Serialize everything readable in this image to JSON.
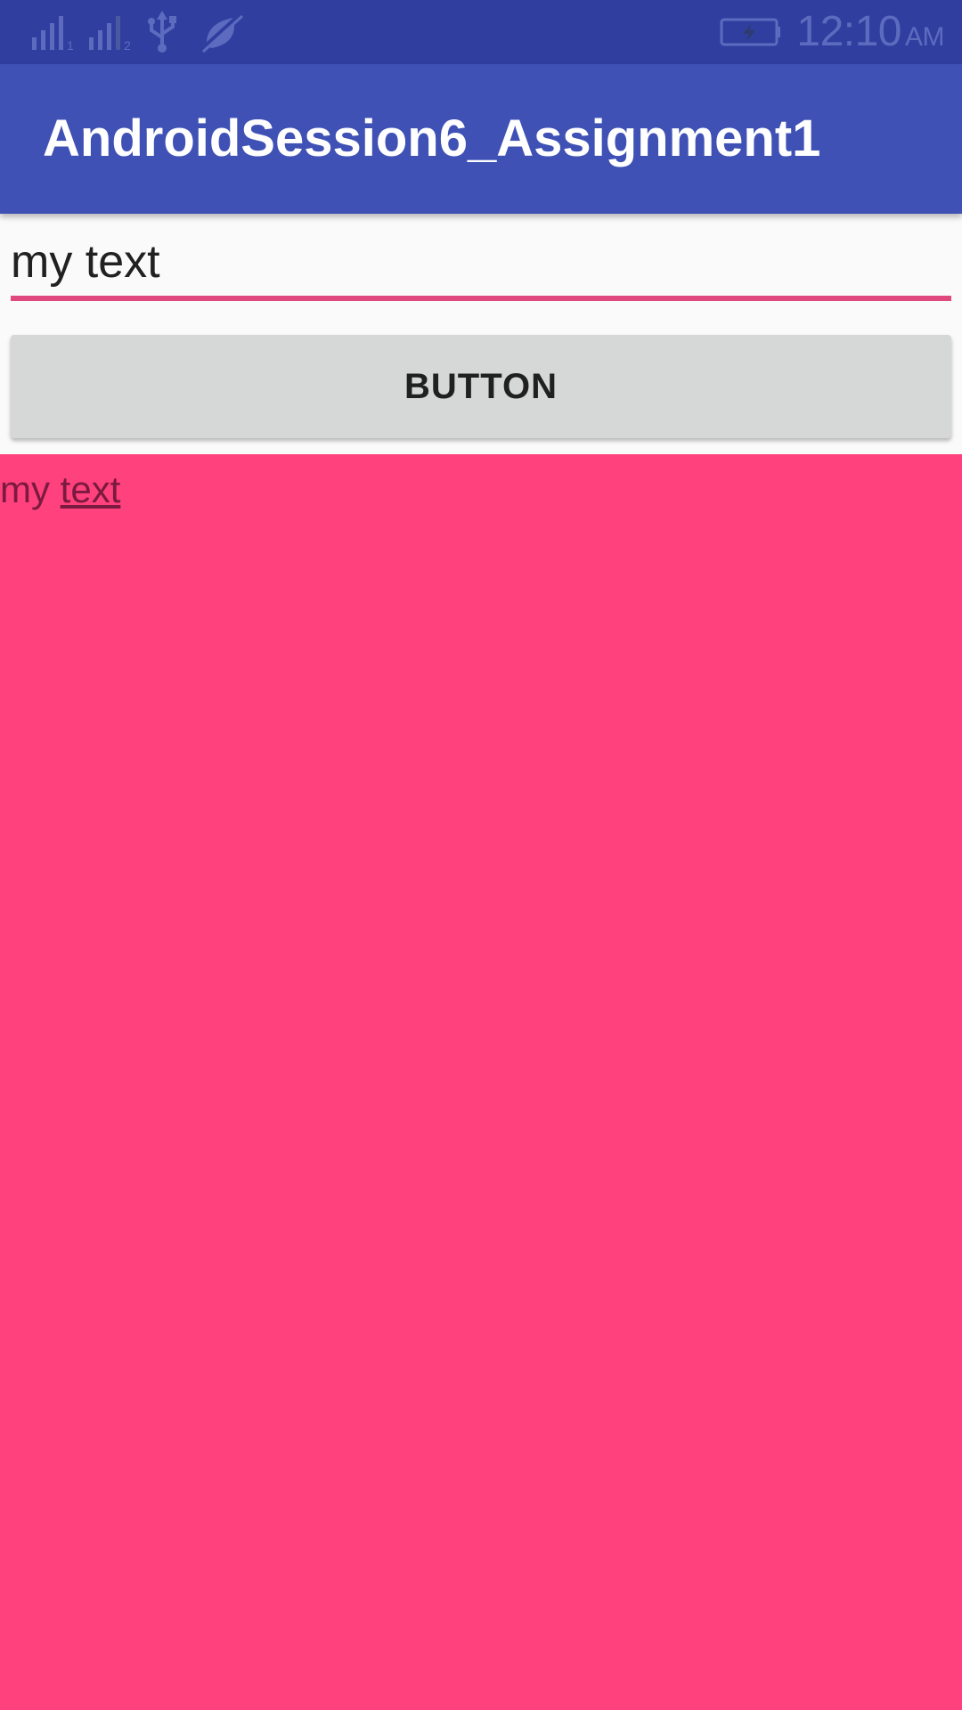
{
  "status_bar": {
    "time": "12:10",
    "ampm": "AM",
    "icons": [
      "signal-sim1-icon",
      "signal-sim2-icon",
      "usb-icon",
      "no-data-icon",
      "battery-charging-icon"
    ],
    "sim1_label": "1",
    "sim2_label": "2",
    "color": "#303f9f"
  },
  "app_bar": {
    "title": "AndroidSession6_Assignment1",
    "color": "#3f51b5"
  },
  "edit_text": {
    "value": "my text",
    "underline_color": "#e0497d"
  },
  "button": {
    "label": "BUTTON"
  },
  "output": {
    "word_plain": "my",
    "word_link": "text",
    "background": "#ff417d"
  }
}
